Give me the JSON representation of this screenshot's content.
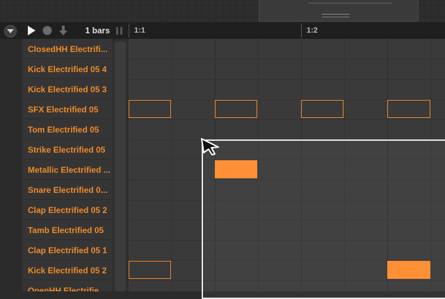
{
  "toolbar": {
    "bars_label": "1 bars",
    "icons": [
      "collapse-chevron-icon",
      "play-icon",
      "record-icon",
      "download-arrow-icon",
      "pause-icon"
    ]
  },
  "ruler": {
    "markers": [
      "1:1",
      "1:2"
    ]
  },
  "tracks": [
    "ClosedHH Electrifi...",
    "Kick Electrified 05 4",
    "Kick Electrified 05 3",
    "SFX Electrified 05",
    "Tom Electrified 05",
    "Strike Electrified 05",
    "Metallic Electrified ...",
    "Snare Electrified 0...",
    "Clap Electrified 05 2",
    "Tamb Electrified 05",
    "Clap Electrified 05 1",
    "Kick Electrified 05 2",
    "OpenHH Electrifie..."
  ],
  "colors": {
    "accent": "#ef8a2a",
    "note_fill": "#ff8c2e",
    "selection": "#e8e8e8"
  }
}
